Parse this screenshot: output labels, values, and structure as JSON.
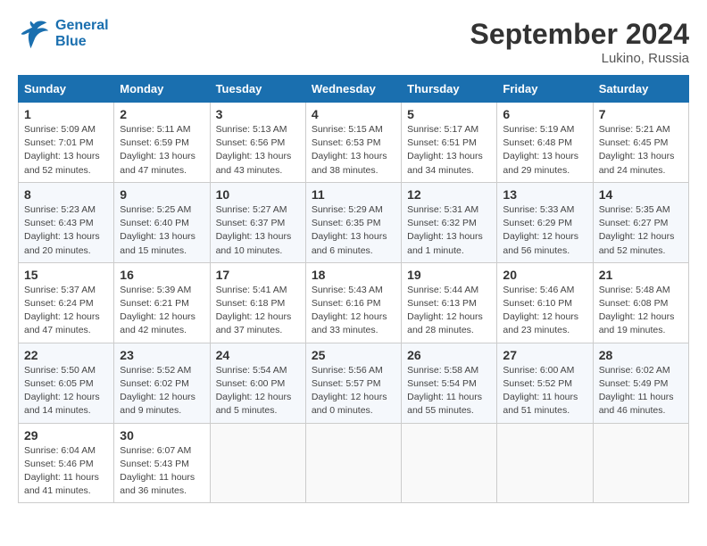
{
  "header": {
    "logo_line1": "General",
    "logo_line2": "Blue",
    "month": "September 2024",
    "location": "Lukino, Russia"
  },
  "weekdays": [
    "Sunday",
    "Monday",
    "Tuesday",
    "Wednesday",
    "Thursday",
    "Friday",
    "Saturday"
  ],
  "weeks": [
    [
      {
        "day": "1",
        "sunrise": "5:09 AM",
        "sunset": "7:01 PM",
        "daylight": "13 hours and 52 minutes."
      },
      {
        "day": "2",
        "sunrise": "5:11 AM",
        "sunset": "6:59 PM",
        "daylight": "13 hours and 47 minutes."
      },
      {
        "day": "3",
        "sunrise": "5:13 AM",
        "sunset": "6:56 PM",
        "daylight": "13 hours and 43 minutes."
      },
      {
        "day": "4",
        "sunrise": "5:15 AM",
        "sunset": "6:53 PM",
        "daylight": "13 hours and 38 minutes."
      },
      {
        "day": "5",
        "sunrise": "5:17 AM",
        "sunset": "6:51 PM",
        "daylight": "13 hours and 34 minutes."
      },
      {
        "day": "6",
        "sunrise": "5:19 AM",
        "sunset": "6:48 PM",
        "daylight": "13 hours and 29 minutes."
      },
      {
        "day": "7",
        "sunrise": "5:21 AM",
        "sunset": "6:45 PM",
        "daylight": "13 hours and 24 minutes."
      }
    ],
    [
      {
        "day": "8",
        "sunrise": "5:23 AM",
        "sunset": "6:43 PM",
        "daylight": "13 hours and 20 minutes."
      },
      {
        "day": "9",
        "sunrise": "5:25 AM",
        "sunset": "6:40 PM",
        "daylight": "13 hours and 15 minutes."
      },
      {
        "day": "10",
        "sunrise": "5:27 AM",
        "sunset": "6:37 PM",
        "daylight": "13 hours and 10 minutes."
      },
      {
        "day": "11",
        "sunrise": "5:29 AM",
        "sunset": "6:35 PM",
        "daylight": "13 hours and 6 minutes."
      },
      {
        "day": "12",
        "sunrise": "5:31 AM",
        "sunset": "6:32 PM",
        "daylight": "13 hours and 1 minute."
      },
      {
        "day": "13",
        "sunrise": "5:33 AM",
        "sunset": "6:29 PM",
        "daylight": "12 hours and 56 minutes."
      },
      {
        "day": "14",
        "sunrise": "5:35 AM",
        "sunset": "6:27 PM",
        "daylight": "12 hours and 52 minutes."
      }
    ],
    [
      {
        "day": "15",
        "sunrise": "5:37 AM",
        "sunset": "6:24 PM",
        "daylight": "12 hours and 47 minutes."
      },
      {
        "day": "16",
        "sunrise": "5:39 AM",
        "sunset": "6:21 PM",
        "daylight": "12 hours and 42 minutes."
      },
      {
        "day": "17",
        "sunrise": "5:41 AM",
        "sunset": "6:18 PM",
        "daylight": "12 hours and 37 minutes."
      },
      {
        "day": "18",
        "sunrise": "5:43 AM",
        "sunset": "6:16 PM",
        "daylight": "12 hours and 33 minutes."
      },
      {
        "day": "19",
        "sunrise": "5:44 AM",
        "sunset": "6:13 PM",
        "daylight": "12 hours and 28 minutes."
      },
      {
        "day": "20",
        "sunrise": "5:46 AM",
        "sunset": "6:10 PM",
        "daylight": "12 hours and 23 minutes."
      },
      {
        "day": "21",
        "sunrise": "5:48 AM",
        "sunset": "6:08 PM",
        "daylight": "12 hours and 19 minutes."
      }
    ],
    [
      {
        "day": "22",
        "sunrise": "5:50 AM",
        "sunset": "6:05 PM",
        "daylight": "12 hours and 14 minutes."
      },
      {
        "day": "23",
        "sunrise": "5:52 AM",
        "sunset": "6:02 PM",
        "daylight": "12 hours and 9 minutes."
      },
      {
        "day": "24",
        "sunrise": "5:54 AM",
        "sunset": "6:00 PM",
        "daylight": "12 hours and 5 minutes."
      },
      {
        "day": "25",
        "sunrise": "5:56 AM",
        "sunset": "5:57 PM",
        "daylight": "12 hours and 0 minutes."
      },
      {
        "day": "26",
        "sunrise": "5:58 AM",
        "sunset": "5:54 PM",
        "daylight": "11 hours and 55 minutes."
      },
      {
        "day": "27",
        "sunrise": "6:00 AM",
        "sunset": "5:52 PM",
        "daylight": "11 hours and 51 minutes."
      },
      {
        "day": "28",
        "sunrise": "6:02 AM",
        "sunset": "5:49 PM",
        "daylight": "11 hours and 46 minutes."
      }
    ],
    [
      {
        "day": "29",
        "sunrise": "6:04 AM",
        "sunset": "5:46 PM",
        "daylight": "11 hours and 41 minutes."
      },
      {
        "day": "30",
        "sunrise": "6:07 AM",
        "sunset": "5:43 PM",
        "daylight": "11 hours and 36 minutes."
      },
      null,
      null,
      null,
      null,
      null
    ]
  ]
}
